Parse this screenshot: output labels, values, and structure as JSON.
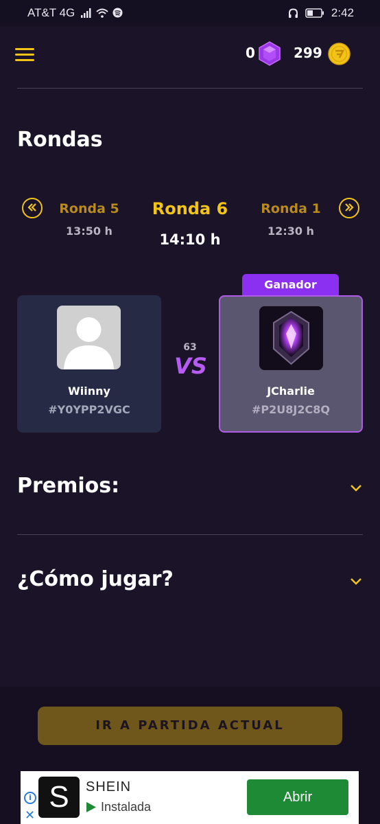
{
  "status_bar": {
    "carrier": "AT&T 4G",
    "time": "2:42"
  },
  "header": {
    "gems": "0",
    "coins": "299",
    "accent_color": "#f2c417"
  },
  "rounds": {
    "title": "Rondas",
    "prev": {
      "name": "Ronda 5",
      "time": "13:50 h"
    },
    "current": {
      "name": "Ronda 6",
      "time": "14:10 h"
    },
    "next": {
      "name": "Ronda 1",
      "time": "12:30 h"
    }
  },
  "match": {
    "player1": {
      "name": "Wiinny",
      "tag": "#Y0YPP2VGC"
    },
    "player2": {
      "name": "JCharlie",
      "tag": "#P2U8J2C8Q"
    },
    "winner_label": "Ganador",
    "score": "63",
    "vs_label": "VS"
  },
  "sections": {
    "prizes": "Premios:",
    "how_to_play": "¿Cómo jugar?"
  },
  "cta_label": "IR A PARTIDA ACTUAL",
  "ad": {
    "logo_letter": "S",
    "app_name": "SHEIN",
    "status": "Instalada",
    "button": "Abrir",
    "info": "i",
    "close": "✕"
  }
}
